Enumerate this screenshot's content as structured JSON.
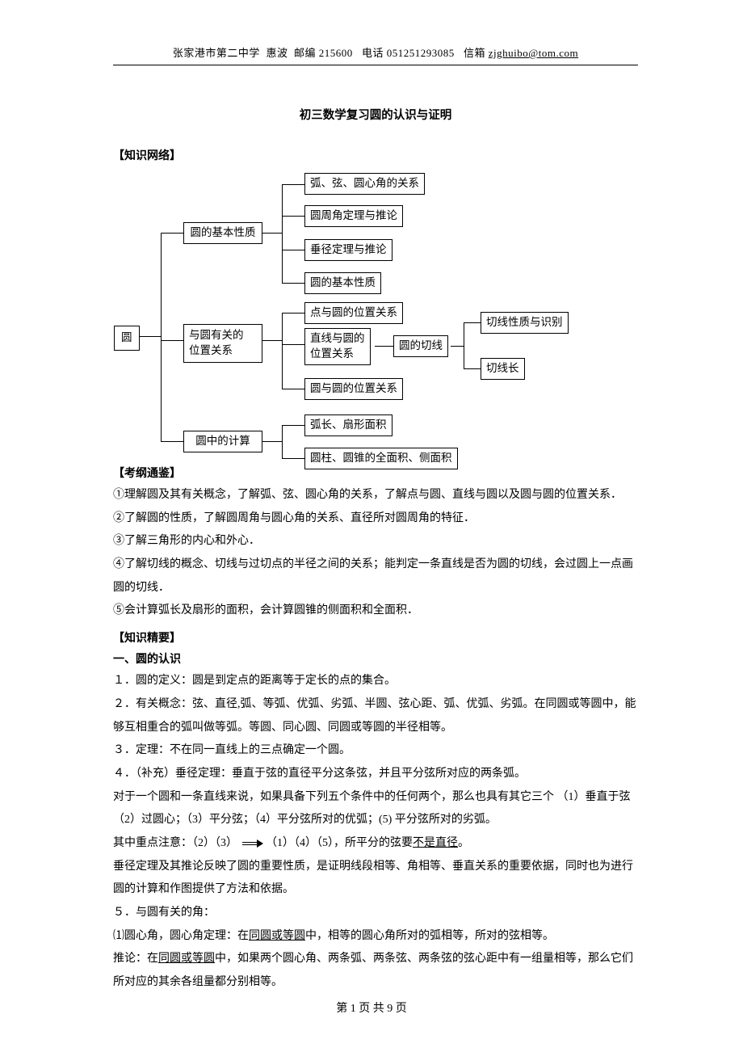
{
  "header": {
    "school": "张家港市第二中学",
    "name": "惠波",
    "postal_label": "邮编",
    "postal": "215600",
    "phone_label": "电话",
    "phone": "051251293085",
    "mail_label": "信箱",
    "mail": "zjghuibo@tom.com"
  },
  "title": "初三数学复习圆的认识与证明",
  "labels": {
    "network": "【知识网络】",
    "outline": "【考纲通鉴】",
    "keypoints": "【知识精要】",
    "sec1": "一、圆的认识"
  },
  "diagram": {
    "root": "圆",
    "b1": "圆的基本性质",
    "b1a": "弧、弦、圆心角的关系",
    "b1b": "圆周角定理与推论",
    "b1c": "垂径定理与推论",
    "b1d": "圆的基本性质",
    "b2l1": "与圆有关的",
    "b2l2": "位置关系",
    "b2a": "点与圆的位置关系",
    "b2b1": "直线与圆的",
    "b2b2": "位置关系",
    "b2b_sub": "圆的切线",
    "b2b_s1": "切线性质与识别",
    "b2b_s2": "切线长",
    "b2c": "圆与圆的位置关系",
    "b3": "圆中的计算",
    "b3a": "弧长、扇形面积",
    "b3b": "圆柱、圆锥的全面积、侧面积"
  },
  "outline": {
    "p1": "①理解圆及其有关概念，了解弧、弦、圆心角的关系，了解点与圆、直线与圆以及圆与圆的位置关系．",
    "p2": "②了解圆的性质，了解圆周角与圆心角的关系、直径所对圆周角的特征．",
    "p3": "③了解三角形的内心和外心．",
    "p4": "④了解切线的概念、切线与过切点的半径之间的关系；能判定一条直线是否为圆的切线，会过圆上一点画圆的切线．",
    "p5": "⑤会计算弧长及扇形的面积，会计算圆锥的侧面积和全面积．"
  },
  "content": {
    "c1": "１．圆的定义：圆是到定点的距离等于定长的点的集合。",
    "c2": "２．有关概念：弦、直径,弧、等弧、优弧、劣弧、半圆、弦心距、弧、优弧、劣弧。在同圆或等圆中，能够互相重合的弧叫做等弧。等圆、同心圆、同圆或等圆的半径相等。",
    "c3": "３．定理：不在同一直线上的三点确定一个圆。",
    "c4": "４．（补充）垂径定理：垂直于弦的直径平分这条弦，并且平分弦所对应的两条弧。",
    "c5": "对于一个圆和一条直线来说，如果具备下列五个条件中的任何两个，那么也具有其它三个 （1）垂直于弦 （2）过圆心；（3）平分弦；（4）平分弦所对的优弧；(5) 平分弦所对的劣弧。",
    "c6a": "其中重点注意：（2）（3）",
    "c6b": "（1）（4）（5），所平分的弦要",
    "c6u": "不是直径",
    "c6c": "。",
    "c7": "垂径定理及其推论反映了圆的重要性质，是证明线段相等、角相等、垂直关系的重要依据，同时也为进行圆的计算和作图提供了方法和依据。",
    "c8": "５．与圆有关的角：",
    "c9a": "⑴圆心角，圆心角定理：在",
    "c9u": "同圆或等圆",
    "c9b": "中，相等的圆心角所对的弧相等，所对的弦相等。",
    "c10a": "推论：在",
    "c10u": "同圆或等圆",
    "c10b": "中，如果两个圆心角、两条弧、两条弦、两条弦的弦心距中有一组量相等，那么它们所对应的其余各组量都分别相等。"
  },
  "footer": {
    "label_a": "第",
    "page": "1",
    "label_b": "页 共",
    "total": "9",
    "label_c": "页"
  }
}
